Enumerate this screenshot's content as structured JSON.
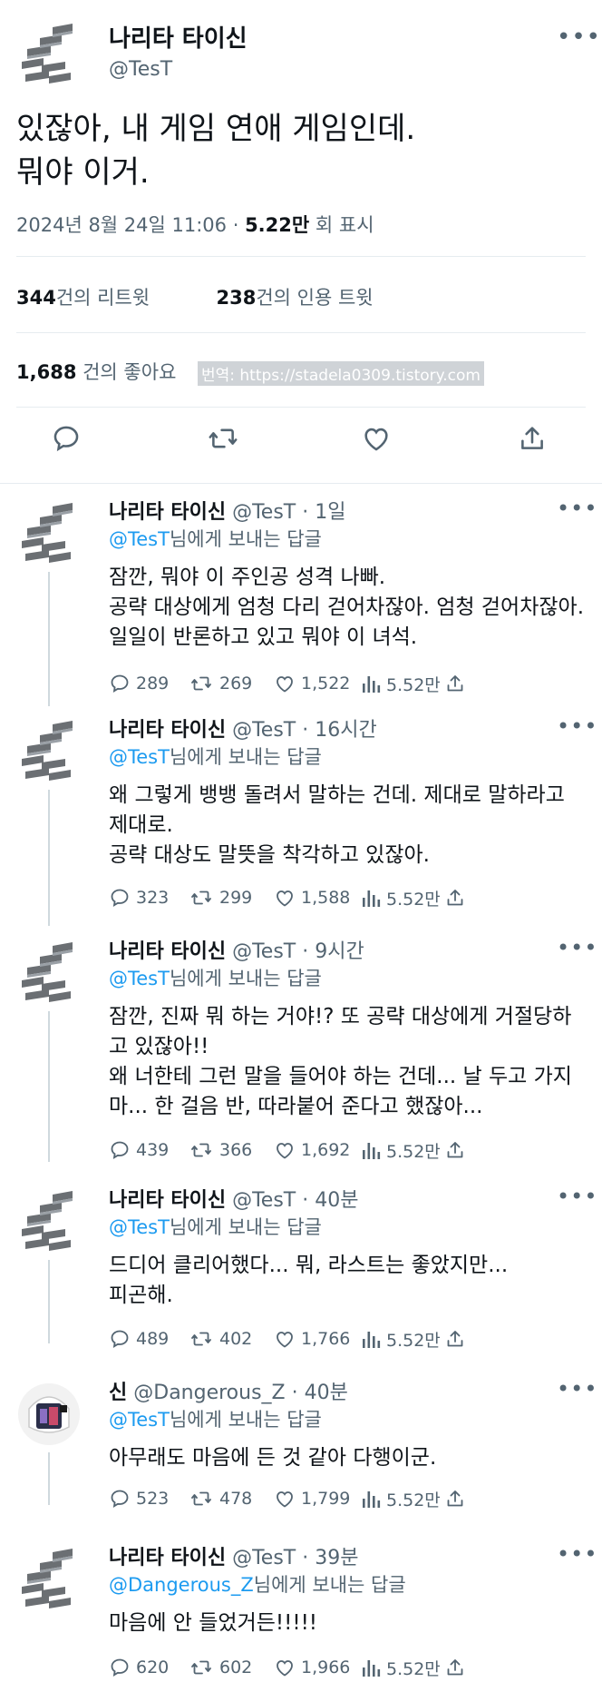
{
  "main_tweet": {
    "author_name": "나리타 타이신",
    "author_handle": "@TesT",
    "more": "•••",
    "text": "있잖아, 내 게임 연애 게임인데.\n뭐야 이거.",
    "date": "2024년 8월 24일 11:06 · ",
    "views_count": "5.22만",
    "views_label": " 회 표시",
    "retweets_count": "344",
    "retweets_label": "건의 리트윗",
    "quotes_count": "238",
    "quotes_label": "건의 인용 트윗",
    "likes_count": "1,688",
    "likes_label": " 건의 좋아요",
    "watermark": "번역: https://stadela0309.tistory.com"
  },
  "replies": [
    {
      "name": "나리타 타이신",
      "handle": "@TesT · 1일",
      "replying_prefix": "",
      "replying_mention": "@TesT",
      "replying_suffix": "님에게 보내는 답글",
      "text": "잠깐, 뭐야 이 주인공 성격 나빠.\n공략 대상에게 엄청 다리 걷어차잖아. 엄청 걷어차잖아. 일일이 반론하고 있고 뭐야 이 녀석.",
      "replies": "289",
      "retweets": "269",
      "likes": "1,522",
      "views": "5.52만"
    },
    {
      "name": "나리타 타이신",
      "handle": "@TesT · 16시간",
      "replying_mention": "@TesT",
      "replying_suffix": "님에게 보내는 답글",
      "text": "왜 그렇게 뱅뱅 돌려서 말하는 건데. 제대로 말하라고 제대로.\n공략 대상도 말뜻을 착각하고 있잖아.",
      "replies": "323",
      "retweets": "299",
      "likes": "1,588",
      "views": "5.52만"
    },
    {
      "name": "나리타 타이신",
      "handle": "@TesT · 9시간",
      "replying_mention": "@TesT",
      "replying_suffix": "님에게 보내는 답글",
      "text": "잠깐, 진짜 뭐 하는 거야!? 또 공략 대상에게 거절당하고 있잖아!!\n왜 너한테 그런 말을 들어야 하는 건데... 날 두고 가지 마... 한 걸음 반, 따라붙어 준다고 했잖아...",
      "replies": "439",
      "retweets": "366",
      "likes": "1,692",
      "views": "5.52만"
    },
    {
      "name": "나리타 타이신",
      "handle": "@TesT · 40분",
      "replying_mention": "@TesT",
      "replying_suffix": "님에게 보내는 답글",
      "text": "드디어 클리어했다... 뭐, 라스트는 좋았지만...\n피곤해.",
      "replies": "489",
      "retweets": "402",
      "likes": "1,766",
      "views": "5.52만"
    },
    {
      "name": "신",
      "handle": "@Dangerous_Z · 40분",
      "replying_mention": "@TesT",
      "replying_suffix": "님에게 보내는 답글",
      "text": "아무래도 마음에 든 것 같아 다행이군.",
      "replies": "523",
      "retweets": "478",
      "likes": "1,799",
      "views": "5.52만"
    },
    {
      "name": "나리타 타이신",
      "handle": "@TesT · 39분",
      "replying_mention": "@Dangerous_Z",
      "replying_suffix": "님에게 보내는 답글",
      "text": "마음에 안 들었거든!!!!!",
      "replies": "620",
      "retweets": "602",
      "likes": "1,966",
      "views": "5.52만"
    }
  ],
  "more_icon": "•••",
  "icons": {
    "reply": "reply-icon",
    "retweet": "retweet-icon",
    "like": "heart-icon",
    "views": "views-icon",
    "share": "share-icon"
  },
  "colors": {
    "text": "#0f1419",
    "secondary": "#536471",
    "link": "#1d9bf0",
    "divider": "#e6ecf0"
  }
}
